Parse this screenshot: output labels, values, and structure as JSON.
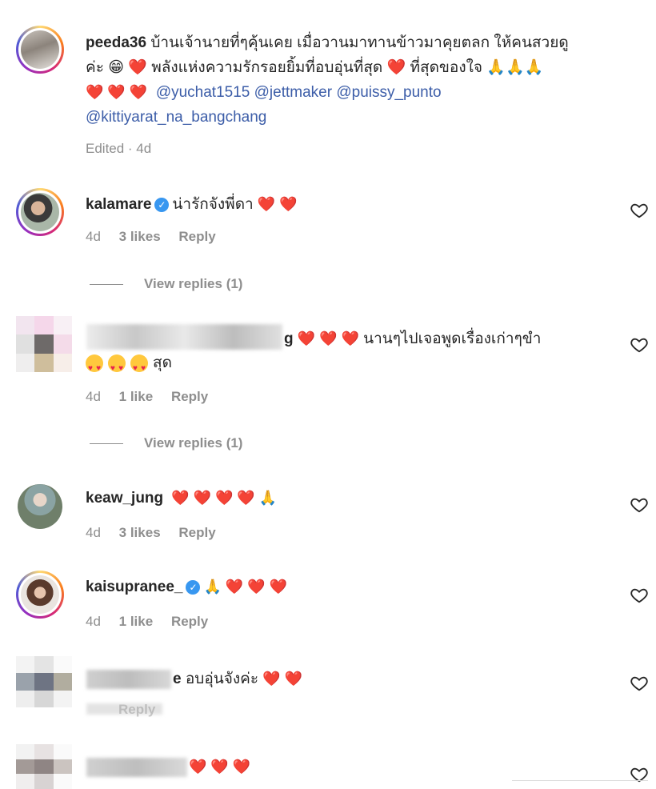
{
  "comments": [
    {
      "id": "c1",
      "user": "peeda36",
      "text_line1": "บ้านเจ้านายที่ๆคุ้นเคย เมื่อวานมาทานข้าวมาคุยตลก ให้คนสวยดู",
      "text_line2": "ค่ะ 😁 ❤️ พลังแห่งความรักรอยยิ้มที่อบอุ่นที่สุด ❤️ ที่สุดของใจ 🙏🙏🙏",
      "mentions": [
        "@yuchat1515",
        "@jettmaker",
        "@puissy_punto",
        "@kittiyarat_na_bangchang"
      ],
      "meta": "Edited · 4d"
    },
    {
      "id": "c2",
      "user": "kalamare",
      "verified": true,
      "text": "น่ารักจังพี่ดา",
      "time": "4d",
      "likes": "3 likes",
      "reply": "Reply",
      "view_replies": "View replies (1)"
    },
    {
      "id": "c3",
      "user_suffix": "g",
      "text": "นานๆไปเจอพูดเรื่องเก่าๆขำ",
      "text2": "สุด",
      "time": "4d",
      "likes": "1 like",
      "reply": "Reply",
      "view_replies": "View replies (1)"
    },
    {
      "id": "c4",
      "user": "keaw_jung",
      "time": "4d",
      "likes": "3 likes",
      "reply": "Reply"
    },
    {
      "id": "c5",
      "user": "kaisupranee_",
      "verified": true,
      "time": "4d",
      "likes": "1 like",
      "reply": "Reply"
    },
    {
      "id": "c6",
      "user_suffix": "e",
      "text": "อบอุ่นจังค่ะ",
      "meta_partial": "Reply"
    },
    {
      "id": "c7"
    }
  ],
  "icons": {
    "heart": "heart-outline-icon",
    "verified": "verified-badge-icon"
  },
  "colors": {
    "mention": "#3c5da8",
    "muted": "#8e8e8e",
    "verified": "#3897f0",
    "heart_emoji": "#e8214e"
  }
}
